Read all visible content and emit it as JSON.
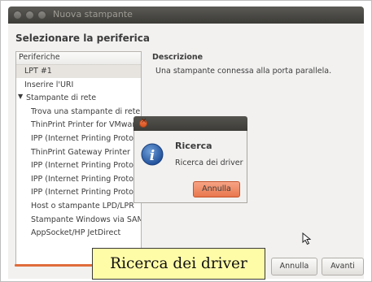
{
  "window": {
    "title": "Nuova stampante",
    "heading": "Selezionare la periferica"
  },
  "devices": {
    "header": "Periferiche",
    "items": [
      {
        "label": "LPT #1",
        "selected": true
      },
      {
        "label": "Inserire l'URI"
      },
      {
        "label": "Stampante di rete",
        "expander": "▼"
      },
      {
        "label": "Trova una stampante di rete"
      },
      {
        "label": "ThinPrint Printer for VMware"
      },
      {
        "label": "IPP (Internet Printing Protocol)"
      },
      {
        "label": "ThinPrint Gateway Printer"
      },
      {
        "label": "IPP (Internet Printing Protocol)"
      },
      {
        "label": "IPP (Internet Printing Protocol)"
      },
      {
        "label": "IPP (Internet Printing Protocol)"
      },
      {
        "label": "Host o stampante LPD/LPR"
      },
      {
        "label": "Stampante Windows via SAMBA"
      },
      {
        "label": "AppSocket/HP JetDirect"
      }
    ]
  },
  "description": {
    "label": "Descrizione",
    "text": "Una stampante connessa alla porta parallela."
  },
  "buttons": {
    "cancel": "Annulla",
    "next": "Avanti"
  },
  "dialog": {
    "heading": "Ricerca",
    "message": "Ricerca dei driver",
    "button": "Annulla",
    "icon": "info-icon"
  },
  "caption": {
    "text": "Ricerca dei driver"
  },
  "colors": {
    "accent": "#e9774d",
    "titlebar": "#3c3b37",
    "caption_bg": "#fffca8"
  }
}
